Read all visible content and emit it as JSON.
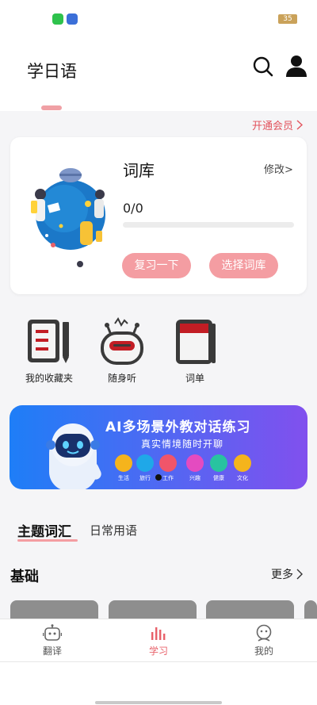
{
  "status_bar": {
    "battery": "35"
  },
  "header": {
    "title": "学日语"
  },
  "vip_link": "开通会员",
  "vocab_card": {
    "title": "词库",
    "edit_label": "修改>",
    "progress_text": "0/0",
    "progress_fraction": 0,
    "review_button": "复习一下",
    "select_button": "选择词库"
  },
  "shortcuts": [
    {
      "label": "我的收藏夹",
      "icon": "notebook-pen-icon"
    },
    {
      "label": "随身听",
      "icon": "robot-radio-icon"
    },
    {
      "label": "词单",
      "icon": "red-book-icon"
    }
  ],
  "ai_banner": {
    "title": "AI多场景外教对话练习",
    "subtitle": "真实情境随时开聊",
    "topics": [
      {
        "label": "生活",
        "color": "#f5b41c"
      },
      {
        "label": "旅行",
        "color": "#1fa8e8"
      },
      {
        "label": "工作",
        "color": "#f0556a"
      },
      {
        "label": "兴趣",
        "color": "#e44bc0"
      },
      {
        "label": "健康",
        "color": "#28c3a0"
      },
      {
        "label": "文化",
        "color": "#f5b41c"
      }
    ]
  },
  "content_tabs": {
    "active": "主题词汇",
    "other": "日常用语"
  },
  "section": {
    "title": "基础",
    "more": "更多"
  },
  "bottom_nav": [
    {
      "label": "翻译",
      "icon": "robot-icon"
    },
    {
      "label": "学习",
      "icon": "chart-bars-icon",
      "active": true
    },
    {
      "label": "我的",
      "icon": "face-icon"
    }
  ],
  "colors": {
    "accent": "#f49da2",
    "accent_text": "#e2525c"
  }
}
